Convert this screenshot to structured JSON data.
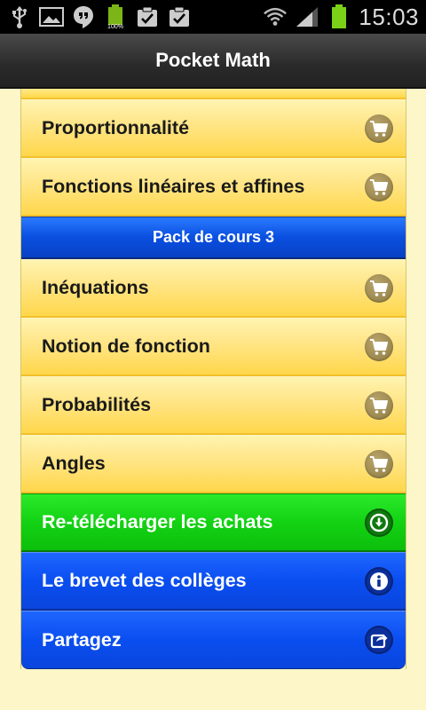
{
  "status_bar": {
    "time": "15:03",
    "battery_small_label": "100%",
    "icons_left": [
      "usb-icon",
      "image-icon",
      "hangouts-icon",
      "battery-full-icon",
      "task-done-icon",
      "task-done-icon"
    ],
    "icons_right": [
      "wifi-icon",
      "signal-icon",
      "battery-icon"
    ]
  },
  "header": {
    "title": "Pocket Math"
  },
  "list": {
    "items_top": [
      {
        "label": "Proportionnalité",
        "icon": "cart-icon"
      },
      {
        "label": "Fonctions linéaires et affines",
        "icon": "cart-icon"
      }
    ],
    "section_header": "Pack de cours 3",
    "items_pack3": [
      {
        "label": "Inéquations",
        "icon": "cart-icon"
      },
      {
        "label": "Notion de fonction",
        "icon": "cart-icon"
      },
      {
        "label": "Probabilités",
        "icon": "cart-icon"
      },
      {
        "label": "Angles",
        "icon": "cart-icon"
      }
    ],
    "actions": [
      {
        "label": "Re-télécharger les achats",
        "icon": "download-circle-icon",
        "color": "#13d213"
      },
      {
        "label": "Le brevet des collèges",
        "icon": "info-icon",
        "color": "#0a4ef0"
      },
      {
        "label": "Partagez",
        "icon": "share-icon",
        "color": "#0a4ef0"
      }
    ]
  },
  "colors": {
    "background": "#fdf6c9",
    "row_yellow": "#ffe68a",
    "section_blue": "#0a4fe0",
    "action_green": "#13d213",
    "action_blue": "#0a4ef0",
    "cart_button": "#9c8950"
  }
}
